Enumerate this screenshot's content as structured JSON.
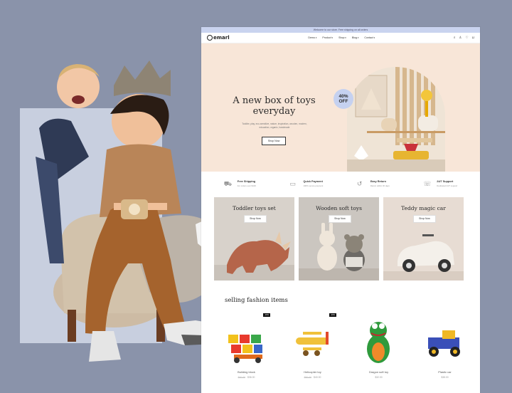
{
  "colors": {
    "page_bg": "#8a93aa",
    "accent": "#c9d3ef",
    "hero_bg": "#f8e6d8"
  },
  "topbar": {
    "text": "Welcome to our store. Free shipping on all orders"
  },
  "header": {
    "logo": "emarl",
    "menu": [
      "Demo",
      "Product",
      "Shop",
      "Blog",
      "Contact"
    ],
    "icons": [
      "search-icon",
      "user-icon",
      "heart-icon",
      "cart-icon"
    ]
  },
  "hero": {
    "title": "A new box of toys everyday",
    "description": "Toddler, play, eco-sensitive, nature, inspiration, wooden, modern, education, organic, handmade",
    "button": "Shop Now",
    "badge_percent": "40%",
    "badge_label": "OFF"
  },
  "features": [
    {
      "title": "Free Shipping",
      "subtitle": "For orders over $100"
    },
    {
      "title": "Quick Payment",
      "subtitle": "100% secure payment"
    },
    {
      "title": "Easy Return",
      "subtitle": "Return within 30 days"
    },
    {
      "title": "24/7 Support",
      "subtitle": "Dedicated 24/7 support"
    }
  ],
  "categories": [
    {
      "title": "Toddler toys set",
      "button": "Shop Now",
      "bg": "#d8d2cb"
    },
    {
      "title": "Wooden soft toys",
      "button": "Shop Now",
      "bg": "#cbc6c0"
    },
    {
      "title": "Teddy magic car",
      "button": "Shop Now",
      "bg": "#e7dcd3"
    }
  ],
  "section": {
    "title": "selling fashion items"
  },
  "products": [
    {
      "name": "Building block",
      "price": "$36.00",
      "old_price": "$40.00",
      "tag": "-10%"
    },
    {
      "name": "Helicopter toy",
      "price": "$40.00",
      "old_price": "$50.00",
      "tag": "-20%"
    },
    {
      "name": "Dragon soft toy",
      "price": "$32.00",
      "old_price": "",
      "tag": ""
    },
    {
      "name": "Plastic car",
      "price": "$38.00",
      "old_price": "",
      "tag": ""
    }
  ]
}
